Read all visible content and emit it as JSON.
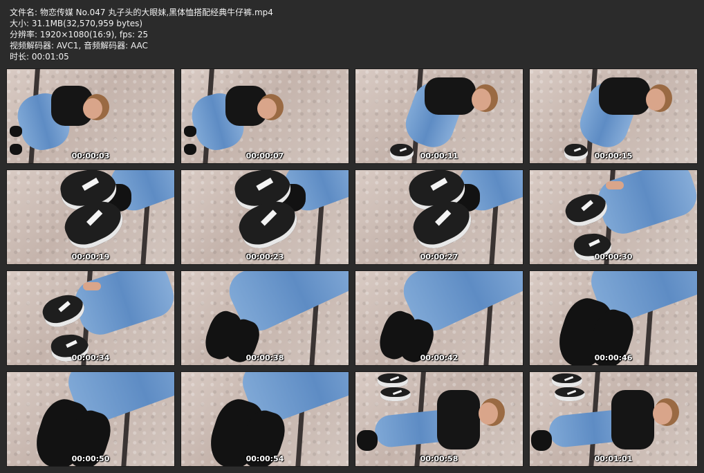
{
  "info": {
    "file_name": "文件名: 物恋传媒 No.047 丸子头的大眼妹,黑体恤搭配经典牛仔裤.mp4",
    "size": "大小: 31.1MB(32,570,959 bytes)",
    "resolution": "分辨率: 1920×1080(16:9), fps: 25",
    "codec": "视频解码器: AVC1, 音频解码器: AAC",
    "duration": "时长: 00:01:05"
  },
  "thumbnails": [
    {
      "timestamp": "00:00:03",
      "scene": "lying-full"
    },
    {
      "timestamp": "00:00:07",
      "scene": "lying-full"
    },
    {
      "timestamp": "00:00:11",
      "scene": "lying-side"
    },
    {
      "timestamp": "00:00:15",
      "scene": "lying-side"
    },
    {
      "timestamp": "00:00:19",
      "scene": "sneakers-close"
    },
    {
      "timestamp": "00:00:23",
      "scene": "sneakers-close"
    },
    {
      "timestamp": "00:00:27",
      "scene": "sneakers-close"
    },
    {
      "timestamp": "00:00:30",
      "scene": "sneakers-hand"
    },
    {
      "timestamp": "00:00:34",
      "scene": "sneakers-hand"
    },
    {
      "timestamp": "00:00:38",
      "scene": "socks"
    },
    {
      "timestamp": "00:00:42",
      "scene": "socks"
    },
    {
      "timestamp": "00:00:46",
      "scene": "socks-close"
    },
    {
      "timestamp": "00:00:50",
      "scene": "socks-close"
    },
    {
      "timestamp": "00:00:54",
      "scene": "socks-close"
    },
    {
      "timestamp": "00:00:58",
      "scene": "sitting-shoes"
    },
    {
      "timestamp": "00:01:01",
      "scene": "sitting-shoes"
    }
  ]
}
